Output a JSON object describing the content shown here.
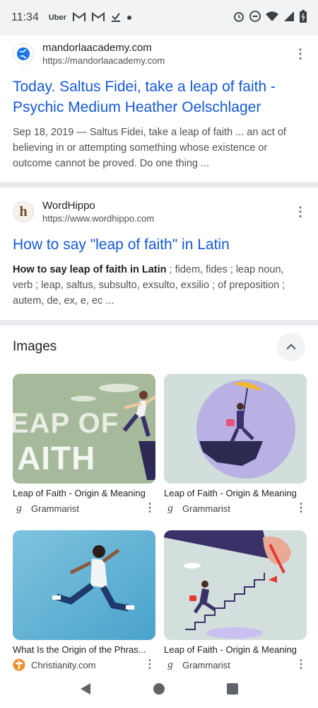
{
  "status_bar": {
    "time": "11:34",
    "notification_icons": [
      "Uber",
      "gmail-icon",
      "gmail-icon",
      "check-download-icon",
      "dot-icon"
    ],
    "system_icons": [
      "alarm-icon",
      "dnd-icon",
      "wifi-icon",
      "signal-icon",
      "battery-icon"
    ]
  },
  "results": [
    {
      "site_name": "mandorlaacademy.com",
      "url": "https://mandorlaacademy.com",
      "title": "Today. Saltus Fidei, take a leap of faith - Psychic Medium Heather Oelschlager",
      "snippet_date": "Sep 18, 2019 — ",
      "snippet": "Saltus Fidei, take a leap of faith ... an act of believing in or attempting something whose existence or outcome cannot be proved. Do one thing ..."
    },
    {
      "site_name": "WordHippo",
      "url": "https://www.wordhippo.com",
      "favicon_letter": "h",
      "title": "How to say \"leap of faith\" in Latin",
      "snippet_bold": "How to say leap of faith in Latin",
      "snippet": " ; fidem, fides ; leap noun, verb ; leap, saltus, subsulto, exsulto, exsilio ; of preposition ; autem, de, ex, e, ec ..."
    }
  ],
  "images_section": {
    "title": "Images",
    "items": [
      {
        "caption": "Leap of Faith - Origin & Meaning",
        "source": "Grammarist",
        "source_icon": "g",
        "thumb_text_1": "EAP OF",
        "thumb_text_2": "AITH"
      },
      {
        "caption": "Leap of Faith - Origin & Meaning",
        "source": "Grammarist",
        "source_icon": "g"
      },
      {
        "caption": "What Is the Origin of the Phras...",
        "source": "Christianity.com",
        "source_icon": "christianity-icon"
      },
      {
        "caption": "Leap of Faith - Origin & Meaning",
        "source": "Grammarist",
        "source_icon": "g"
      }
    ]
  },
  "colors": {
    "link": "#1558d6",
    "snippet": "#4d5156",
    "divider": "#e8eaed",
    "status_bg": "#f1f3f4"
  }
}
